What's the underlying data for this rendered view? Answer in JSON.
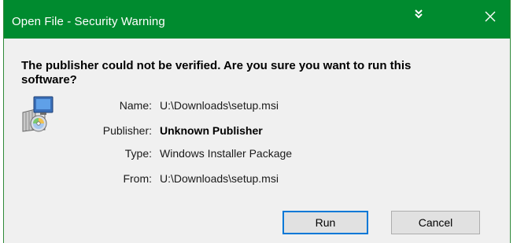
{
  "window": {
    "title": "Open File - Security Warning",
    "accent_color": "#008b2f"
  },
  "titlebar_icons": {
    "collapse": "double-chevron-down-icon",
    "close": "close-icon"
  },
  "message": {
    "heading": "The publisher could not be verified.  Are you sure you want to run this software?",
    "icon": "windows-installer-package-icon"
  },
  "details": [
    {
      "label": "Name:",
      "value": "U:\\Downloads\\setup.msi",
      "bold": false
    },
    {
      "label": "Publisher:",
      "value": "Unknown Publisher",
      "bold": true
    },
    {
      "label": "Type:",
      "value": "Windows Installer Package",
      "bold": false
    },
    {
      "label": "From:",
      "value": "U:\\Downloads\\setup.msi",
      "bold": false
    }
  ],
  "buttons": {
    "run": "Run",
    "cancel": "Cancel"
  }
}
